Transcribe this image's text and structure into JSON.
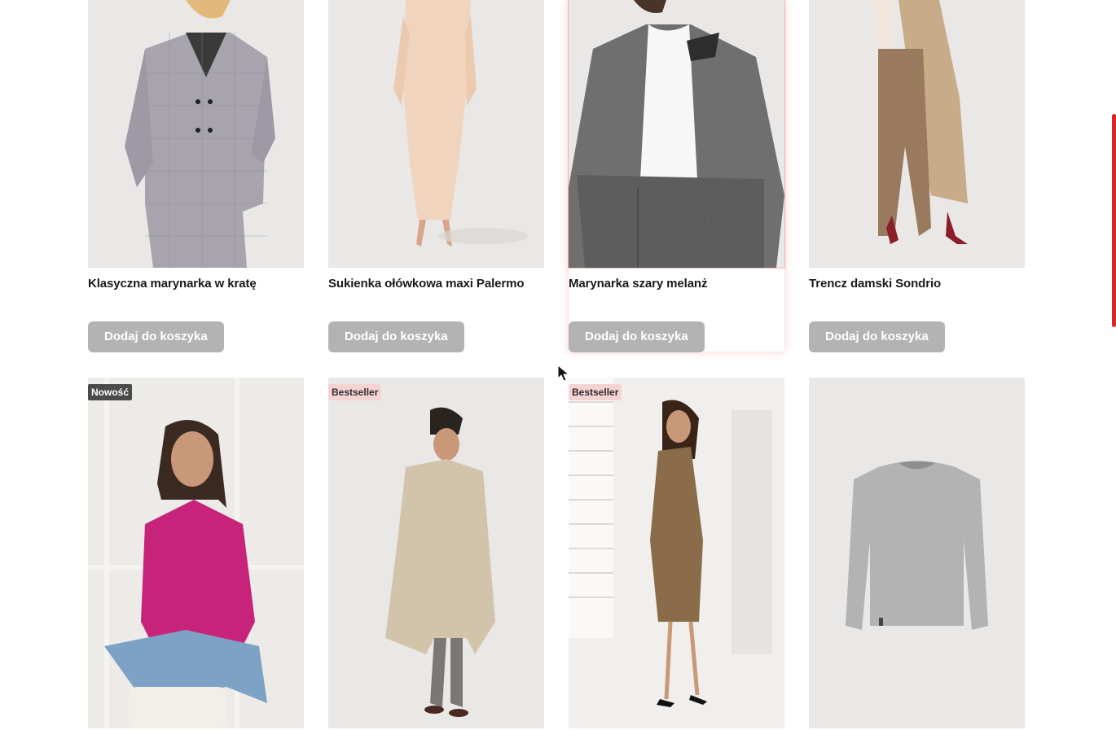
{
  "products": [
    {
      "title": "Klasyczna marynarka w kratę",
      "button": "Dodaj do koszyka",
      "image": "woman-checked-blazer"
    },
    {
      "title": "Sukienka ołówkowa maxi Palermo",
      "button": "Dodaj do koszyka",
      "image": "woman-beige-pencil-dress"
    },
    {
      "title": "Marynarka szary melanż",
      "button": "Dodaj do koszyka",
      "image": "woman-grey-blazer",
      "hovered": true
    },
    {
      "title": "Trencz damski Sondrio",
      "button": "Dodaj do koszyka",
      "image": "woman-trench-coat"
    },
    {
      "badge": "Nowość",
      "image": "woman-pink-sweater"
    },
    {
      "badge": "Bestseller",
      "image": "man-beige-trench-coat"
    },
    {
      "badge": "Bestseller",
      "image": "woman-brown-dress"
    },
    {
      "image": "grey-long-sleeve-shirt"
    }
  ],
  "colors": {
    "accent": "#d62828",
    "button_bg": "#b3b3b3",
    "image_bg": "#e9e8e6",
    "badge_new": "#4a4a4a",
    "badge_bestseller": "#f6d3d3"
  }
}
